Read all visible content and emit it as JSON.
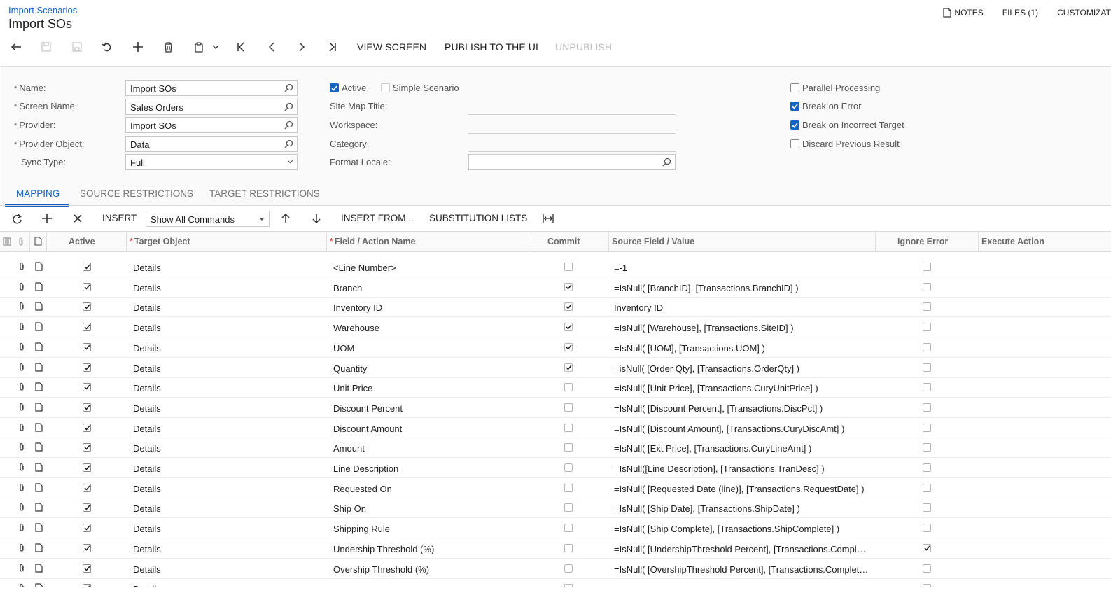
{
  "header": {
    "breadcrumb": "Import Scenarios",
    "title": "Import SOs",
    "links": {
      "notes": "NOTES",
      "files": "FILES (1)",
      "customization": "CUSTOMIZAT"
    }
  },
  "toolbar": {
    "view_screen": "VIEW SCREEN",
    "publish": "PUBLISH TO THE UI",
    "unpublish": "UNPUBLISH"
  },
  "form": {
    "name_label": "Name:",
    "name_value": "Import SOs",
    "screen_label": "Screen Name:",
    "screen_value": "Sales Orders",
    "provider_label": "Provider:",
    "provider_value": "Import SOs",
    "provider_object_label": "Provider Object:",
    "provider_object_value": "Data",
    "sync_label": "Sync Type:",
    "sync_value": "Full",
    "active_label": "Active",
    "simple_label": "Simple Scenario",
    "sitemap_label": "Site Map Title:",
    "workspace_label": "Workspace:",
    "category_label": "Category:",
    "locale_label": "Format Locale:",
    "parallel_label": "Parallel Processing",
    "break_error_label": "Break on Error",
    "break_target_label": "Break on Incorrect Target",
    "discard_label": "Discard Previous Result"
  },
  "tabs": [
    "MAPPING",
    "SOURCE RESTRICTIONS",
    "TARGET RESTRICTIONS"
  ],
  "grid_toolbar": {
    "insert": "INSERT",
    "show_commands": "Show All Commands",
    "insert_from": "INSERT FROM...",
    "substitution": "SUBSTITUTION LISTS"
  },
  "columns": {
    "active": "Active",
    "target": "Target Object",
    "field": "Field / Action Name",
    "commit": "Commit",
    "source": "Source Field / Value",
    "ignore": "Ignore Error",
    "execute": "Execute Action"
  },
  "rows": [
    {
      "target": "Details",
      "field": "<Line Number>",
      "commit": false,
      "source": "=-1",
      "ignore": false
    },
    {
      "target": "Details",
      "field": "Branch",
      "commit": true,
      "source": "=IsNull( [BranchID], [Transactions.BranchID] )",
      "ignore": false
    },
    {
      "target": "Details",
      "field": "Inventory ID",
      "commit": true,
      "source": "Inventory ID",
      "ignore": false
    },
    {
      "target": "Details",
      "field": "Warehouse",
      "commit": true,
      "source": "=IsNull( [Warehouse], [Transactions.SiteID] )",
      "ignore": false
    },
    {
      "target": "Details",
      "field": "UOM",
      "commit": true,
      "source": "=IsNull( [UOM], [Transactions.UOM] )",
      "ignore": false
    },
    {
      "target": "Details",
      "field": "Quantity",
      "commit": true,
      "source": "=isNull( [Order Qty], [Transactions.OrderQty] )",
      "ignore": false
    },
    {
      "target": "Details",
      "field": "Unit Price",
      "commit": false,
      "source": "=IsNull( [Unit Price], [Transactions.CuryUnitPrice] )",
      "ignore": false
    },
    {
      "target": "Details",
      "field": "Discount Percent",
      "commit": false,
      "source": "=IsNull( [Discount Percent], [Transactions.DiscPct] )",
      "ignore": false
    },
    {
      "target": "Details",
      "field": "Discount Amount",
      "commit": false,
      "source": "=IsNull( [Discount Amount], [Transactions.CuryDiscAmt] )",
      "ignore": false
    },
    {
      "target": "Details",
      "field": "Amount",
      "commit": false,
      "source": "=IsNull( [Ext Price], [Transactions.CuryLineAmt] )",
      "ignore": false
    },
    {
      "target": "Details",
      "field": "Line Description",
      "commit": false,
      "source": "=IsNull([Line Description], [Transactions.TranDesc] )",
      "ignore": false
    },
    {
      "target": "Details",
      "field": "Requested On",
      "commit": false,
      "source": "=IsNull( [Requested Date (line)], [Transactions.RequestDate] )",
      "ignore": false
    },
    {
      "target": "Details",
      "field": "Ship On",
      "commit": false,
      "source": "=IsNull( [Ship Date], [Transactions.ShipDate] )",
      "ignore": false
    },
    {
      "target": "Details",
      "field": "Shipping Rule",
      "commit": false,
      "source": "=IsNull( [Ship Complete], [Transactions.ShipComplete] )",
      "ignore": false
    },
    {
      "target": "Details",
      "field": "Undership Threshold (%)",
      "commit": false,
      "source": "=IsNull( [UndershipThreshold Percent], [Transactions.CompleteQtyMin] )",
      "ignore": true
    },
    {
      "target": "Details",
      "field": "Overship Threshold (%)",
      "commit": false,
      "source": "=IsNull( [OvershipThreshold Percent], [Transactions.CompleteQtyMax] )",
      "ignore": false
    },
    {
      "target": "Details",
      "field": "",
      "commit": false,
      "source": "",
      "ignore": false
    }
  ]
}
